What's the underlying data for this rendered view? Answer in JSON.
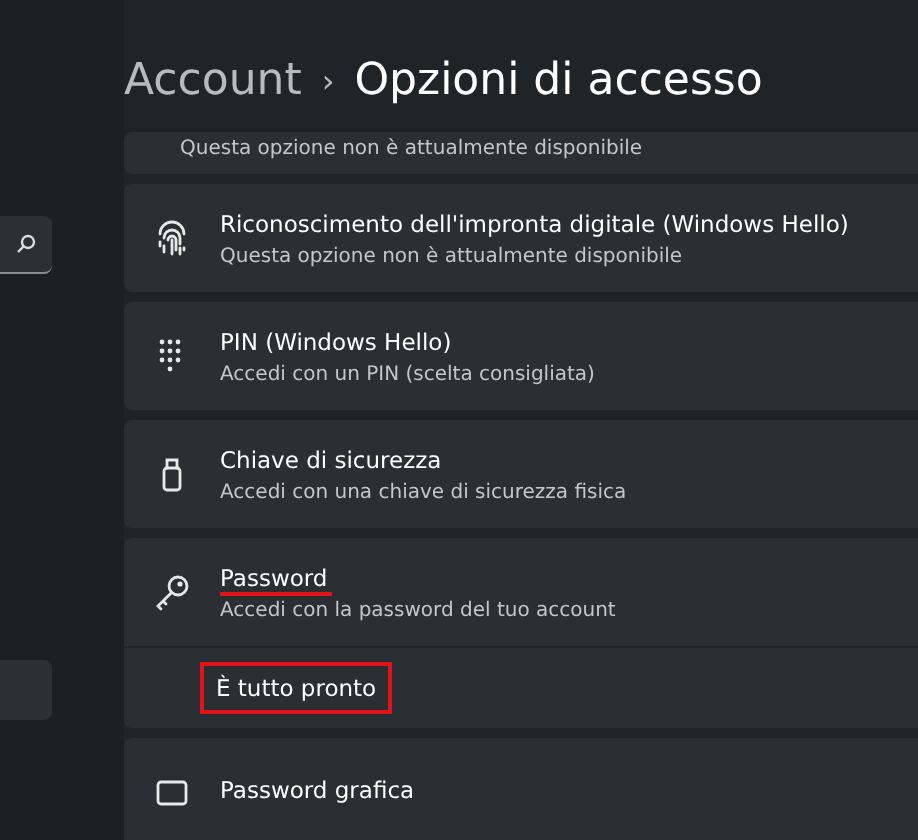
{
  "breadcrumb": {
    "parent": "Account",
    "separator": "›",
    "current": "Opzioni di accesso"
  },
  "options": [
    {
      "kind": "partial",
      "subtitle": "Questa opzione non è attualmente disponibile"
    },
    {
      "kind": "fingerprint",
      "title": "Riconoscimento dell'impronta digitale (Windows Hello)",
      "subtitle": "Questa opzione non è attualmente disponibile"
    },
    {
      "kind": "pin",
      "title": "PIN (Windows Hello)",
      "subtitle": "Accedi con un PIN (scelta consigliata)"
    },
    {
      "kind": "usbkey",
      "title": "Chiave di sicurezza",
      "subtitle": "Accedi con una chiave di sicurezza fisica"
    },
    {
      "kind": "key",
      "title": "Password",
      "subtitle": "Accedi con la password del tuo account",
      "underlined": true,
      "expanded": true,
      "detail": {
        "text": "È tutto pronto",
        "boxed": true
      }
    },
    {
      "kind": "picture-password",
      "title": "Password grafica"
    }
  ]
}
